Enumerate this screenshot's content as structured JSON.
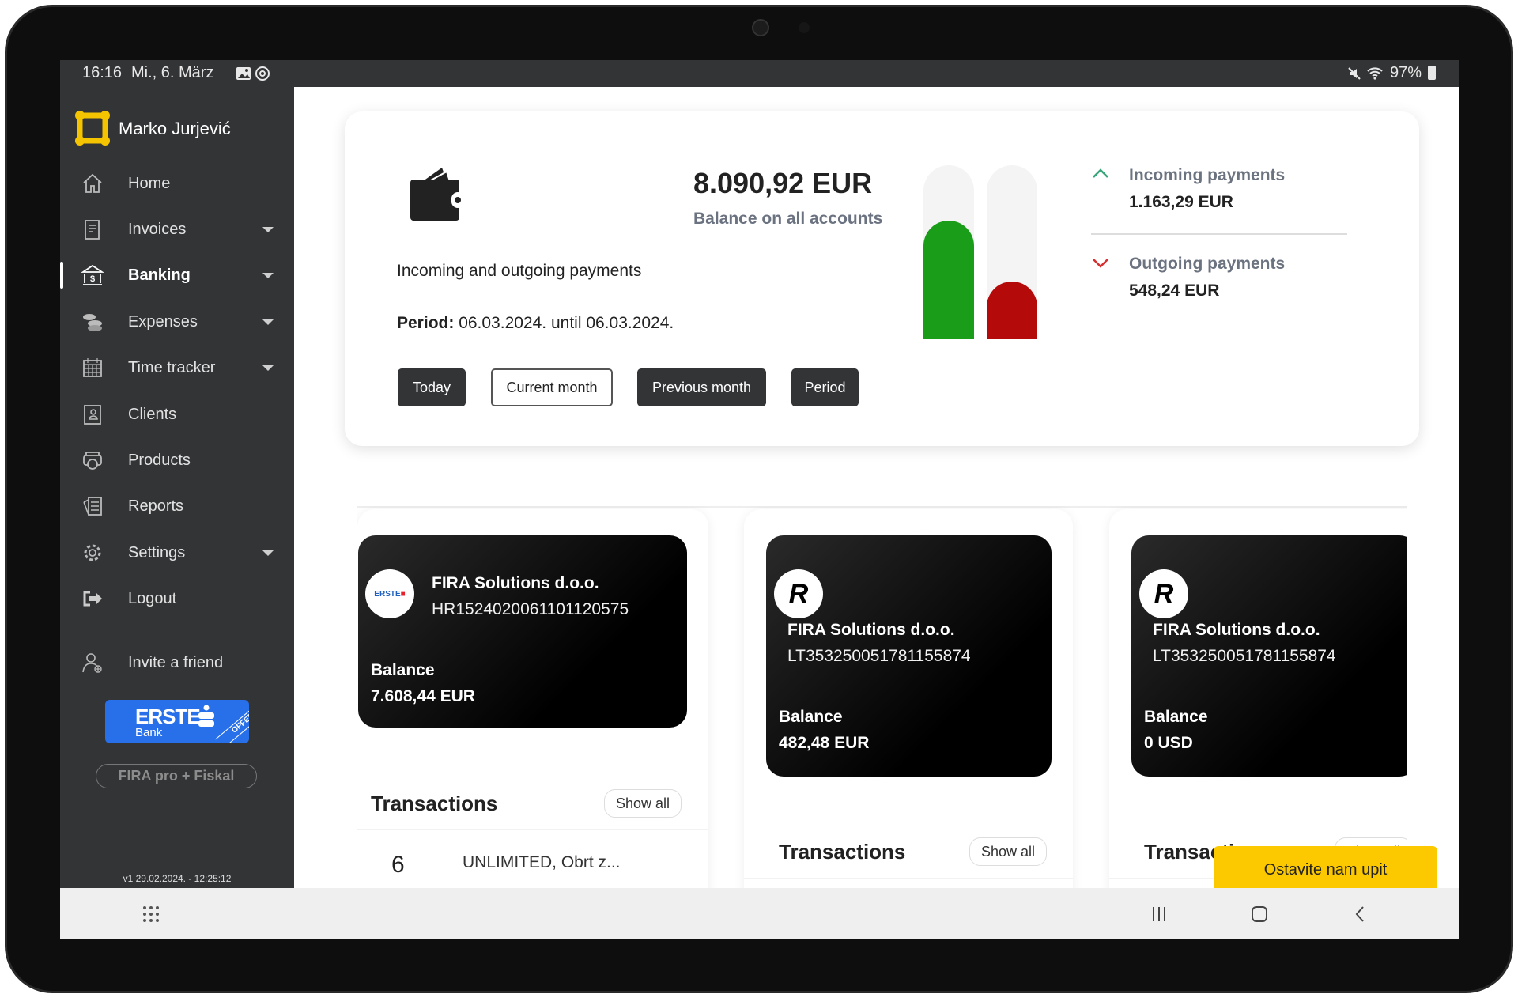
{
  "status_bar": {
    "time": "16:16",
    "date": "Mi., 6. März",
    "battery": "97%",
    "icons": [
      "gallery-icon",
      "sync-icon",
      "mute-icon",
      "wifi-icon",
      "battery-icon"
    ]
  },
  "sidebar": {
    "user_name": "Marko Jurjević",
    "logo_color": "#f5c400",
    "items": [
      {
        "label": "Home",
        "icon": "home-icon",
        "expandable": false
      },
      {
        "label": "Invoices",
        "icon": "invoice-icon",
        "expandable": true
      },
      {
        "label": "Banking",
        "icon": "bank-icon",
        "expandable": true,
        "active": true
      },
      {
        "label": "Expenses",
        "icon": "coins-icon",
        "expandable": true
      },
      {
        "label": "Time tracker",
        "icon": "calendar-icon",
        "expandable": true
      },
      {
        "label": "Clients",
        "icon": "contact-icon",
        "expandable": false
      },
      {
        "label": "Products",
        "icon": "products-icon",
        "expandable": false
      },
      {
        "label": "Reports",
        "icon": "reports-icon",
        "expandable": false
      },
      {
        "label": "Settings",
        "icon": "gear-icon",
        "expandable": true
      },
      {
        "label": "Logout",
        "icon": "logout-icon",
        "expandable": false
      }
    ],
    "invite_label": "Invite a friend",
    "erste_banner": {
      "brand": "ERSTE",
      "sub": "Bank",
      "ribbon": "OFFER",
      "color": "#2870ea"
    },
    "plan_label": "FIRA pro + Fiskal",
    "version": "v1 29.02.2024. - 12:25:12"
  },
  "summary": {
    "total_balance": "8.090,92 EUR",
    "total_balance_label": "Balance on all accounts",
    "subtitle": "Incoming and outgoing payments",
    "period_label": "Period:",
    "period_value": "06.03.2024. until 06.03.2024.",
    "buttons": [
      "Today",
      "Current month",
      "Previous month",
      "Period"
    ],
    "selected_button": "Current month",
    "incoming": {
      "label": "Incoming payments",
      "amount": "1.163,29 EUR",
      "color": "#1a9e1a",
      "bar_fill": 0.68
    },
    "outgoing": {
      "label": "Outgoing payments",
      "amount": "548,24 EUR",
      "color": "#b50a0a",
      "bar_fill": 0.33
    }
  },
  "accounts": [
    {
      "bank": "Erste",
      "name": "FIRA Solutions d.o.o.",
      "iban": "HR1524020061101120575",
      "balance_label": "Balance",
      "balance": "7.608,44 EUR",
      "transactions_title": "Transactions",
      "show_all": "Show all",
      "transactions": [
        {
          "day": "6",
          "description": "UNLIMITED, Obrt z..."
        }
      ]
    },
    {
      "bank": "Revolut",
      "logo_letter": "R",
      "name": "FIRA Solutions d.o.o.",
      "iban": "LT353250051781155874",
      "balance_label": "Balance",
      "balance": "482,48 EUR",
      "transactions_title": "Transactions",
      "show_all": "Show all"
    },
    {
      "bank": "Revolut",
      "logo_letter": "R",
      "name": "FIRA Solutions d.o.o.",
      "iban": "LT353250051781155874",
      "balance_label": "Balance",
      "balance": "0 USD",
      "transactions_title": "Transactions",
      "show_all": "Show all"
    }
  ],
  "contact_button": {
    "label": "Ostavite nam upit",
    "color": "#fcc800"
  },
  "android_nav": {
    "icons": [
      "apps-icon",
      "recents-icon",
      "home-button-icon",
      "back-icon"
    ]
  }
}
